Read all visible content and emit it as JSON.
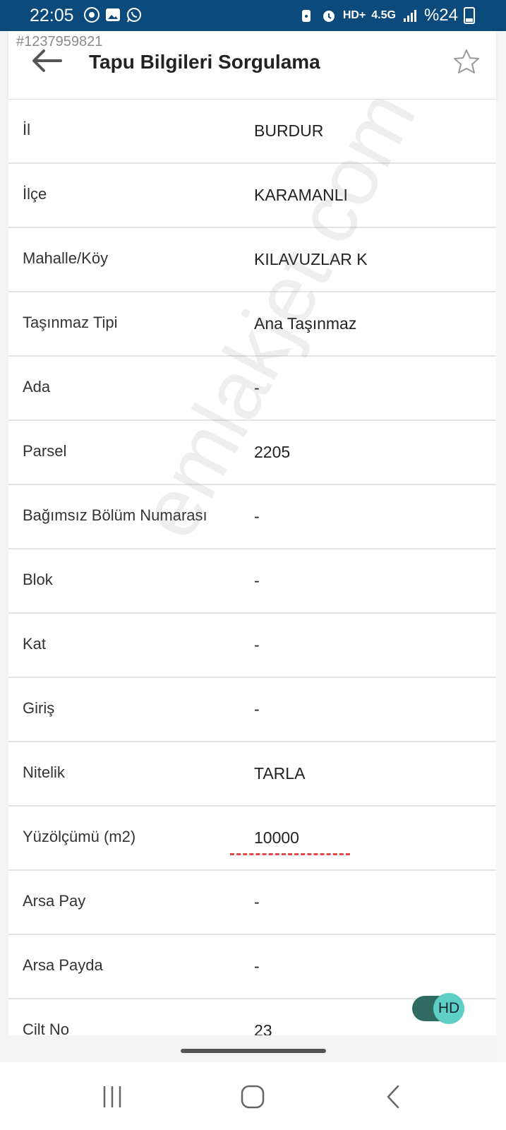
{
  "status_bar": {
    "time": "22:05",
    "network": "HD+",
    "signal_type": "4.5G",
    "battery": "%24"
  },
  "app_bar": {
    "listing_id": "#1237959821",
    "title": "Tapu Bilgileri Sorgulama"
  },
  "rows": [
    {
      "label": "İl",
      "value": "BURDUR"
    },
    {
      "label": "İlçe",
      "value": "KARAMANLI"
    },
    {
      "label": "Mahalle/Köy",
      "value": "KILAVUZLAR K"
    },
    {
      "label": "Taşınmaz Tipi",
      "value": "Ana Taşınmaz"
    },
    {
      "label": "Ada",
      "value": "-"
    },
    {
      "label": "Parsel",
      "value": "2205"
    },
    {
      "label": "Bağımsız Bölüm Numarası",
      "value": "-"
    },
    {
      "label": "Blok",
      "value": "-"
    },
    {
      "label": "Kat",
      "value": "-"
    },
    {
      "label": "Giriş",
      "value": "-"
    },
    {
      "label": "Nitelik",
      "value": "TARLA"
    },
    {
      "label": "Yüzölçümü (m2)",
      "value": "10000"
    },
    {
      "label": "Arsa Pay",
      "value": "-"
    },
    {
      "label": "Arsa Payda",
      "value": "-"
    },
    {
      "label": "Cilt No",
      "value": "23"
    }
  ],
  "watermark": "emlakjet.com",
  "hd_toggle": {
    "label": "HD"
  },
  "colors": {
    "status_bar": "#0b4a7a",
    "toggle_track": "#2f6b60",
    "toggle_knob": "#5ed0c3",
    "underline": "#e04a4a"
  }
}
